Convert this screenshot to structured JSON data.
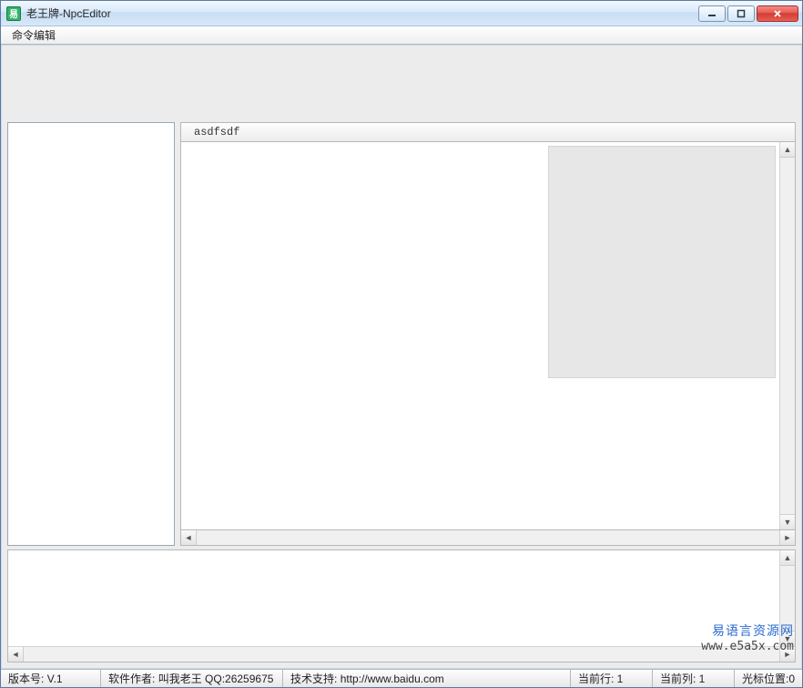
{
  "window": {
    "title": "老王牌-NpcEditor"
  },
  "menu": {
    "item1": "命令编辑"
  },
  "editor": {
    "header_text": "asdfsdf"
  },
  "status": {
    "version_label": "版本号:",
    "version_value": "V.1",
    "author_label": "软件作者:",
    "author_value": "叫我老王 QQ:26259675",
    "support_label": "技术支持:",
    "support_value": "http://www.baidu.com",
    "row_label": "当前行:",
    "row_value": "1",
    "col_label": "当前列:",
    "col_value": "1",
    "caret_label": "光标位置:",
    "caret_value": "0"
  },
  "watermark": {
    "line1": "易语言资源网",
    "line2": "www.e5a5x.com"
  }
}
